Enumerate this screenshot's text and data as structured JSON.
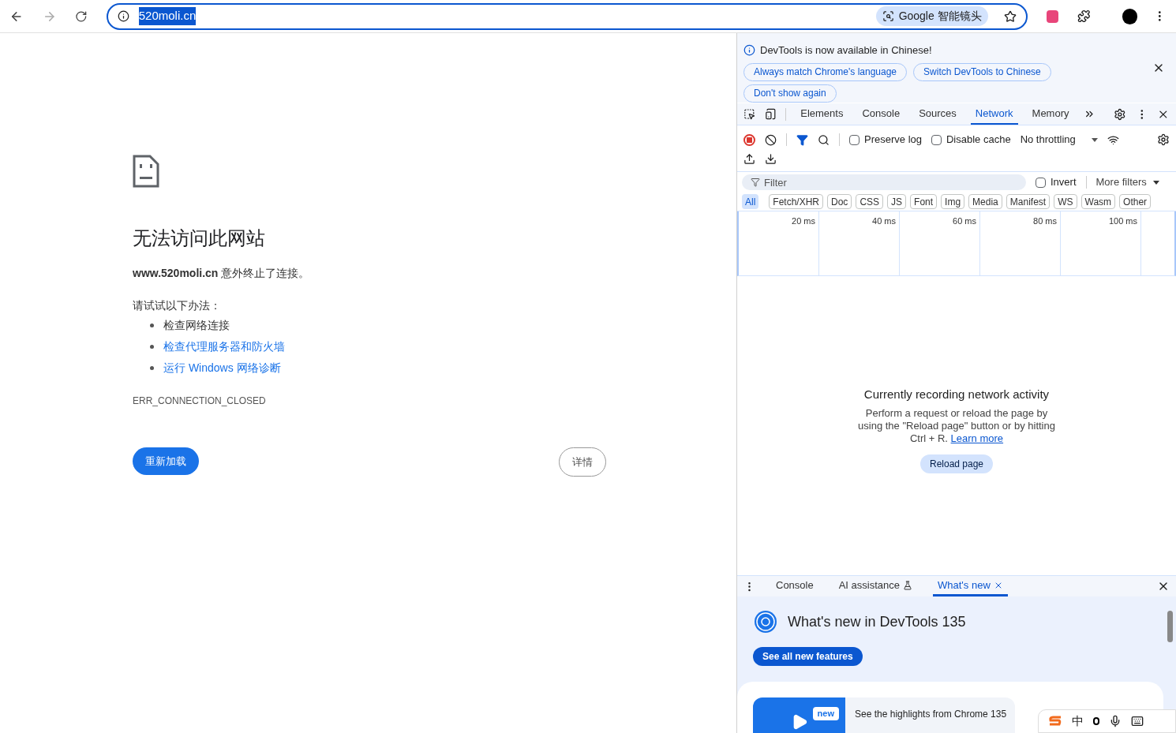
{
  "toolbar": {
    "url": "520moli.cn",
    "lens_label": "Google 智能镜头"
  },
  "error_page": {
    "title": "无法访问此网站",
    "message": "**www.520moli.cn** 意外终止了连接。",
    "suggestions_heading": "请试试以下办法：",
    "suggestions": [
      {
        "text": "检查网络连接",
        "kind": "plain"
      },
      {
        "text": "检查代理服务器和防火墙",
        "kind": "link"
      },
      {
        "text": "运行 Windows 网络诊断",
        "kind": "link"
      }
    ],
    "error_code": "ERR_CONNECTION_CLOSED",
    "reload_button": "重新加载",
    "details_button": "详情"
  },
  "devtools": {
    "infobar": {
      "message": "DevTools is now available in Chinese!",
      "buttons": [
        "Always match Chrome's language",
        "Switch DevTools to Chinese",
        "Don't show again"
      ]
    },
    "tabs": [
      {
        "label": "Elements",
        "selected": false
      },
      {
        "label": "Console",
        "selected": false
      },
      {
        "label": "Sources",
        "selected": false
      },
      {
        "label": "Network",
        "selected": true
      },
      {
        "label": "Memory",
        "selected": false
      }
    ],
    "network": {
      "recording": true,
      "filter_active": true,
      "preserve_log": {
        "label": "Preserve log",
        "checked": false
      },
      "disable_cache": {
        "label": "Disable cache",
        "checked": false
      },
      "throttling": "No throttling",
      "filter": {
        "placeholder": "Filter"
      },
      "invert": {
        "label": "Invert",
        "checked": false
      },
      "more_filters": "More filters",
      "type_filters": [
        {
          "label": "All",
          "selected": true
        },
        {
          "label": "Fetch/XHR",
          "selected": false
        },
        {
          "label": "Doc",
          "selected": false
        },
        {
          "label": "CSS",
          "selected": false
        },
        {
          "label": "JS",
          "selected": false
        },
        {
          "label": "Font",
          "selected": false
        },
        {
          "label": "Img",
          "selected": false
        },
        {
          "label": "Media",
          "selected": false
        },
        {
          "label": "Manifest",
          "selected": false
        },
        {
          "label": "WS",
          "selected": false
        },
        {
          "label": "Wasm",
          "selected": false
        },
        {
          "label": "Other",
          "selected": false
        }
      ],
      "timeline_ticks": [
        "20 ms",
        "40 ms",
        "60 ms",
        "80 ms",
        "100 ms"
      ],
      "empty_state": {
        "title": "Currently recording network activity",
        "text": "Perform a request or reload the page by using the \"Reload page\" button or by hitting Ctrl + R.",
        "link": "Learn more",
        "button": "Reload page"
      }
    },
    "drawer": {
      "tabs": [
        {
          "label": "Console",
          "selected": false,
          "kind": "plain"
        },
        {
          "label": "AI assistance",
          "selected": false,
          "kind": "experimental"
        },
        {
          "label": "What's new",
          "selected": true,
          "kind": "closable"
        }
      ],
      "whats_new": {
        "title": "What's new in DevTools 135",
        "button": "See all new features",
        "card_badge": "new",
        "card_text": "See the highlights from Chrome 135"
      }
    }
  },
  "ime": {
    "mode": "中"
  }
}
